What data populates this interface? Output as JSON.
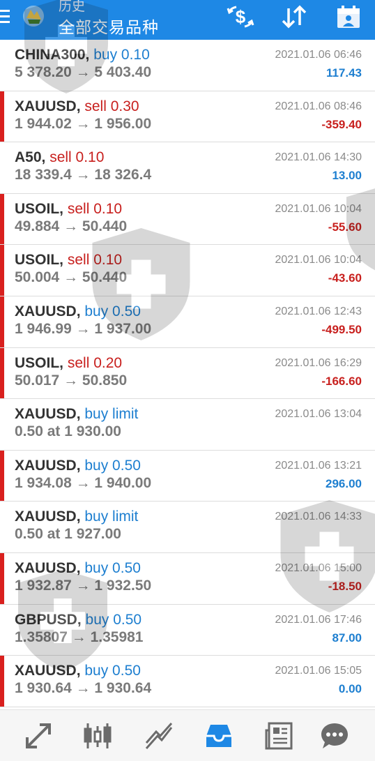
{
  "header": {
    "subtitle": "历史",
    "title": "全部交易品种",
    "icons": [
      "menu-icon",
      "app-logo-icon",
      "currency-filter-icon",
      "sort-icon",
      "calendar-icon"
    ]
  },
  "colors": {
    "header_bg": "#1e88e5",
    "buy": "#1e7fd0",
    "sell": "#c8201e",
    "loss_bar": "#d9201e"
  },
  "trades": [
    {
      "symbol": "CHINA300",
      "type": "buy",
      "volume": "buy 0.10",
      "prices": "5 378.20 → 5 403.40",
      "time": "2021.01.06 06:46",
      "profit": "117.43",
      "loss": false
    },
    {
      "symbol": "XAUUSD",
      "type": "sell",
      "volume": "sell 0.30",
      "prices": "1 944.02 → 1 956.00",
      "time": "2021.01.06 08:46",
      "profit": "-359.40",
      "loss": true
    },
    {
      "symbol": "A50",
      "type": "sell",
      "volume": "sell 0.10",
      "prices": "18 339.4 → 18 326.4",
      "time": "2021.01.06 14:30",
      "profit": "13.00",
      "loss": false
    },
    {
      "symbol": "USOIL",
      "type": "sell",
      "volume": "sell 0.10",
      "prices": "49.884 → 50.440",
      "time": "2021.01.06 10:04",
      "profit": "-55.60",
      "loss": true
    },
    {
      "symbol": "USOIL",
      "type": "sell",
      "volume": "sell 0.10",
      "prices": "50.004 → 50.440",
      "time": "2021.01.06 10:04",
      "profit": "-43.60",
      "loss": true
    },
    {
      "symbol": "XAUUSD",
      "type": "buy",
      "volume": "buy 0.50",
      "prices": "1 946.99 → 1 937.00",
      "time": "2021.01.06 12:43",
      "profit": "-499.50",
      "loss": true
    },
    {
      "symbol": "USOIL",
      "type": "sell",
      "volume": "sell 0.20",
      "prices": "50.017 → 50.850",
      "time": "2021.01.06 16:29",
      "profit": "-166.60",
      "loss": true
    },
    {
      "symbol": "XAUUSD",
      "type": "buy",
      "volume": "buy limit",
      "prices": "0.50 at 1 930.00",
      "time": "2021.01.06 13:04",
      "profit": "",
      "loss": false
    },
    {
      "symbol": "XAUUSD",
      "type": "buy",
      "volume": "buy 0.50",
      "prices": "1 934.08 → 1 940.00",
      "time": "2021.01.06 13:21",
      "profit": "296.00",
      "loss": true
    },
    {
      "symbol": "XAUUSD",
      "type": "buy",
      "volume": "buy limit",
      "prices": "0.50 at 1 927.00",
      "time": "2021.01.06 14:33",
      "profit": "",
      "loss": false
    },
    {
      "symbol": "XAUUSD",
      "type": "buy",
      "volume": "buy 0.50",
      "prices": "1 932.87 → 1 932.50",
      "time": "2021.01.06 15:00",
      "profit": "-18.50",
      "loss": true
    },
    {
      "symbol": "GBPUSD",
      "type": "buy",
      "volume": "buy 0.50",
      "prices": "1.35807 → 1.35981",
      "time": "2021.01.06 17:46",
      "profit": "87.00",
      "loss": false
    },
    {
      "symbol": "XAUUSD",
      "type": "buy",
      "volume": "buy 0.50",
      "prices": "1 930.64 → 1 930.64",
      "time": "2021.01.06 15:05",
      "profit": "0.00",
      "loss": true
    }
  ],
  "bottom_nav": [
    {
      "name": "quotes-icon"
    },
    {
      "name": "chart-icon"
    },
    {
      "name": "trade-icon"
    },
    {
      "name": "history-icon",
      "active": true
    },
    {
      "name": "news-icon"
    },
    {
      "name": "chat-icon"
    }
  ]
}
